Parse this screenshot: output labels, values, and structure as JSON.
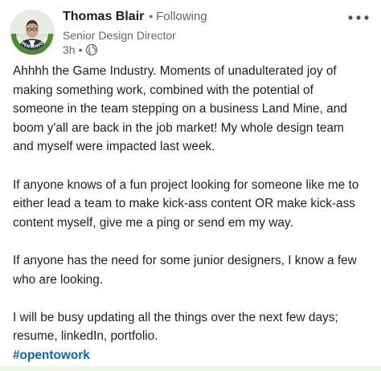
{
  "post": {
    "author_name": "Thomas Blair",
    "separator": "•",
    "follow_status": "Following",
    "headline": "Senior Design Director",
    "time": "3h",
    "time_separator": "•",
    "visibility_icon": "globe-icon",
    "more_icon": "ellipsis-icon",
    "avatar_frame_text": "#OPENTOWORK",
    "paragraphs": [
      "Ahhhh the Game Industry. Moments of unadulterated joy of\nmaking something work, combined with the potential of\nsomeone in the team stepping on a business Land Mine, and\nboom y'all are back in the job market! My whole design team\nand myself were impacted last week.",
      "If anyone knows of a fun project looking for someone like me to\neither lead a team to make kick-ass content OR make kick-ass\ncontent myself, give me a ping or send em my way.",
      "If anyone has the need for some junior designers, I know a few\nwho are looking.",
      "I will be busy updating all the things over the next few days;\nresume, linkedIn, portfolio."
    ],
    "hashtag": "#opentowork"
  },
  "colors": {
    "link": "#0a66c2",
    "open_to_work": "#4a8b2c",
    "secondary_text": "#666666"
  }
}
